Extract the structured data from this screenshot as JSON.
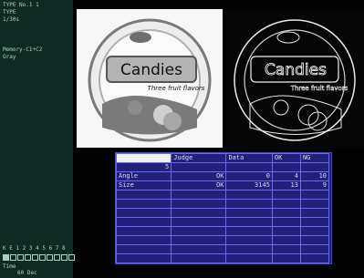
{
  "sidebar": {
    "line1": "TYPE No.1 1",
    "line2": "TYPE",
    "line3": "1/30s",
    "line4": "Memory-C1+C2",
    "line5": "Gray"
  },
  "images": {
    "left_label": "Candies",
    "left_subtitle": "Three fruit flavors",
    "right_label": "Candies",
    "right_subtitle": "Three fruit flavors"
  },
  "table": {
    "headers": [
      "",
      "Judge",
      "Data",
      "OK",
      "NG"
    ],
    "row_num": "5",
    "rows": [
      [
        "Angle",
        "OK",
        "0",
        "4",
        "10"
      ],
      [
        "Size",
        "OK",
        "3145",
        "13",
        "9"
      ]
    ]
  },
  "status": {
    "label": "K E 1 2 3 4 5 6 7 8",
    "sub1": "Time",
    "sub2": "60 Dec"
  }
}
